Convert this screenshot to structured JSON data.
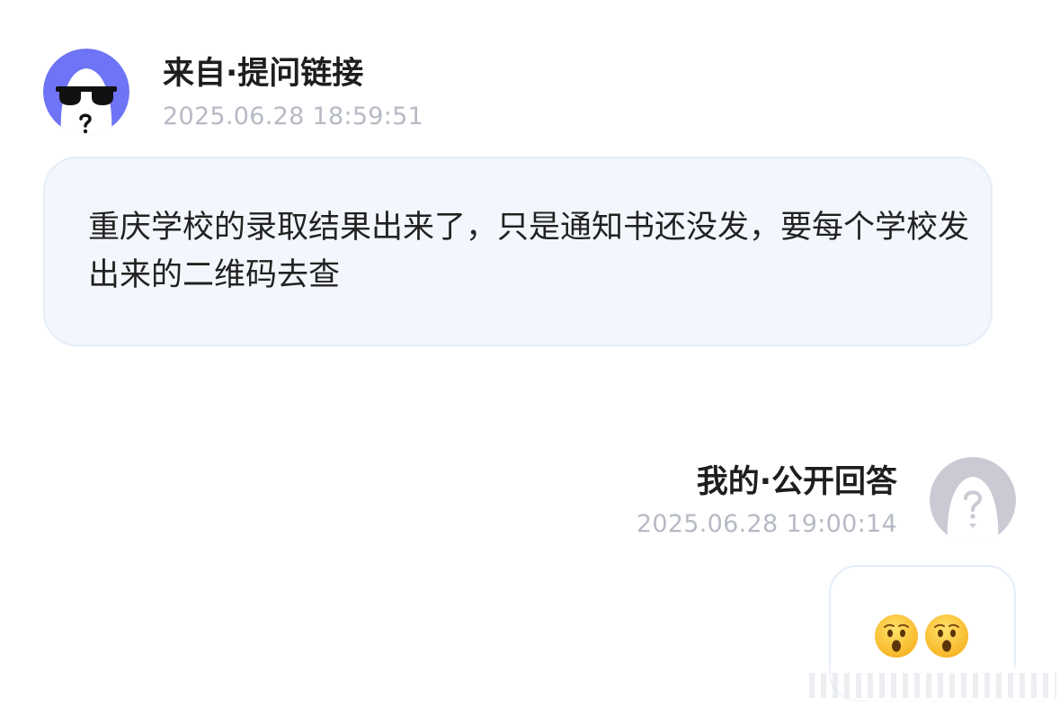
{
  "question": {
    "sender_label": "来自·提问链接",
    "timestamp": "2025.06.28 18:59:51",
    "text": "重庆学校的录取结果出来了，只是通知书还没发，要每个学校发出来的二维码去查",
    "avatar_icon": "sunglasses-face-icon",
    "avatar_color": "#6e74f5"
  },
  "answer": {
    "sender_label": "我的·公开回答",
    "timestamp": "2025.06.28 19:00:14",
    "emojis": [
      "😲",
      "😲"
    ],
    "avatar_icon": "question-mark-face-icon",
    "avatar_color": "#c9cad3"
  },
  "colors": {
    "bubble_bg": "#f3f7fd",
    "timestamp": "#b6bac4"
  }
}
